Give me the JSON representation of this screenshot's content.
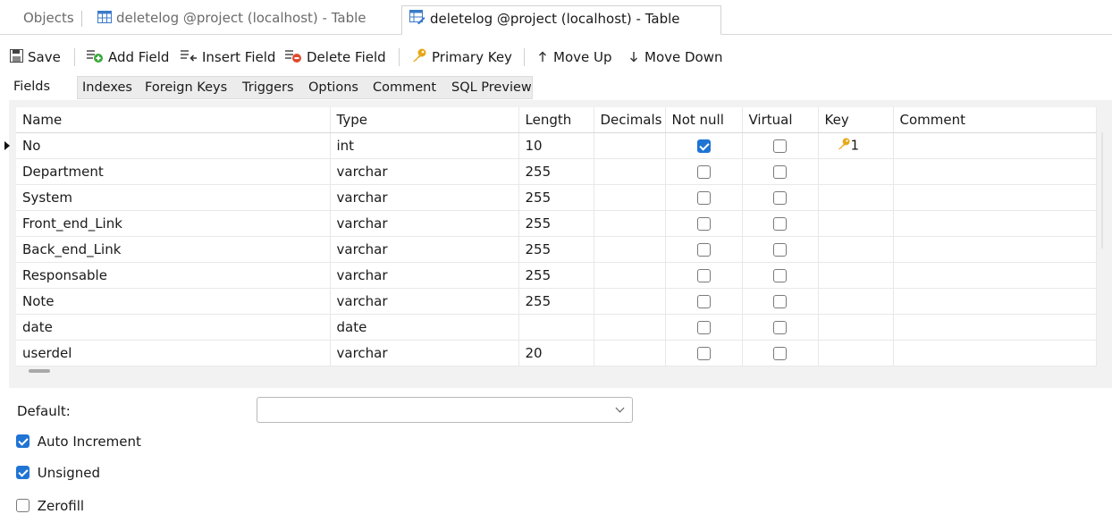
{
  "doc_tabs": [
    {
      "label": "Objects",
      "active": false
    },
    {
      "label": "deletelog @project (localhost) - Table",
      "active": false,
      "icon": "table-icon"
    },
    {
      "label": "deletelog @project (localhost) - Table",
      "active": true,
      "icon": "table-design-icon"
    }
  ],
  "toolbar": {
    "save": "Save",
    "add_field": "Add Field",
    "insert_field": "Insert Field",
    "delete_field": "Delete Field",
    "primary_key": "Primary Key",
    "move_up": "Move Up",
    "move_down": "Move Down"
  },
  "sub_tabs": [
    "Fields",
    "Indexes",
    "Foreign Keys",
    "Triggers",
    "Options",
    "Comment",
    "SQL Preview"
  ],
  "grid": {
    "columns": [
      "Name",
      "Type",
      "Length",
      "Decimals",
      "Not null",
      "Virtual",
      "Key",
      "Comment"
    ],
    "rows": [
      {
        "name": "No",
        "type": "int",
        "length": "10",
        "decimals": "",
        "not_null": true,
        "virtual": false,
        "key": "1",
        "comment": ""
      },
      {
        "name": "Department",
        "type": "varchar",
        "length": "255",
        "decimals": "",
        "not_null": false,
        "virtual": false,
        "key": "",
        "comment": ""
      },
      {
        "name": "System",
        "type": "varchar",
        "length": "255",
        "decimals": "",
        "not_null": false,
        "virtual": false,
        "key": "",
        "comment": ""
      },
      {
        "name": "Front_end_Link",
        "type": "varchar",
        "length": "255",
        "decimals": "",
        "not_null": false,
        "virtual": false,
        "key": "",
        "comment": ""
      },
      {
        "name": "Back_end_Link",
        "type": "varchar",
        "length": "255",
        "decimals": "",
        "not_null": false,
        "virtual": false,
        "key": "",
        "comment": ""
      },
      {
        "name": "Responsable",
        "type": "varchar",
        "length": "255",
        "decimals": "",
        "not_null": false,
        "virtual": false,
        "key": "",
        "comment": ""
      },
      {
        "name": "Note",
        "type": "varchar",
        "length": "255",
        "decimals": "",
        "not_null": false,
        "virtual": false,
        "key": "",
        "comment": ""
      },
      {
        "name": "date",
        "type": "date",
        "length": "",
        "decimals": "",
        "not_null": false,
        "virtual": false,
        "key": "",
        "comment": ""
      },
      {
        "name": "userdel",
        "type": "varchar",
        "length": "20",
        "decimals": "",
        "not_null": false,
        "virtual": false,
        "key": "",
        "comment": ""
      }
    ]
  },
  "properties": {
    "default_label": "Default:",
    "default_value": "",
    "auto_increment": {
      "label": "Auto Increment",
      "checked": true
    },
    "unsigned": {
      "label": "Unsigned",
      "checked": true
    },
    "zerofill": {
      "label": "Zerofill",
      "checked": false
    }
  },
  "colors": {
    "accent": "#1f74d4",
    "key_icon": "#e6a817"
  }
}
